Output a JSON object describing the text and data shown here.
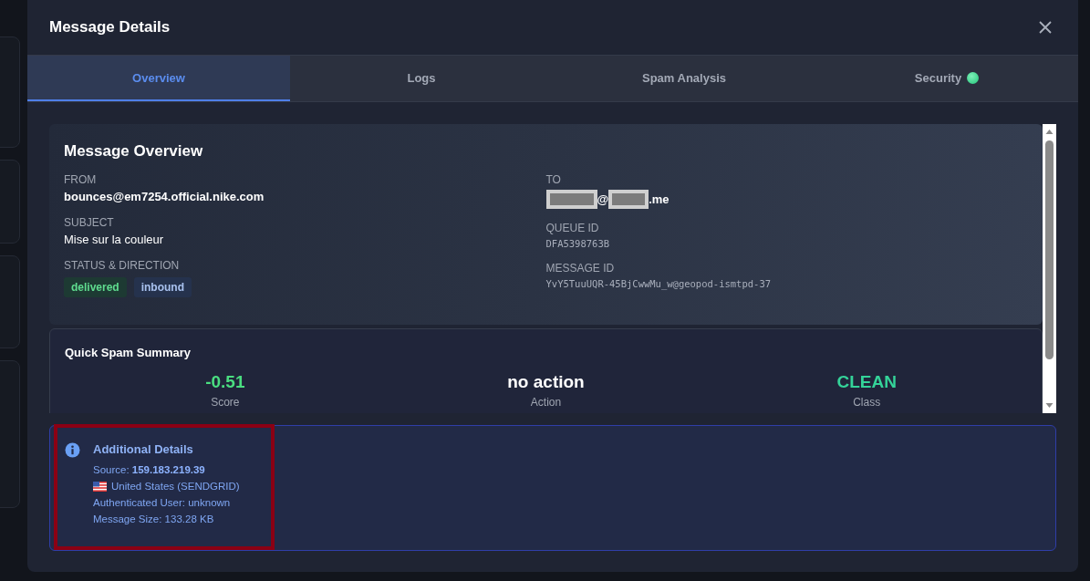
{
  "window": {
    "title": "Message Details"
  },
  "tabs": [
    {
      "label": "Overview",
      "selected": true,
      "indicator": false
    },
    {
      "label": "Logs",
      "selected": false,
      "indicator": false
    },
    {
      "label": "Spam Analysis",
      "selected": false,
      "indicator": false
    },
    {
      "label": "Security",
      "selected": false,
      "indicator": true
    }
  ],
  "overview": {
    "title": "Message Overview",
    "from": {
      "label": "FROM",
      "value": "bounces@em7254.official.nike.com"
    },
    "subject": {
      "label": "SUBJECT",
      "value": "Mise sur la couleur"
    },
    "status": {
      "label": "STATUS & DIRECTION",
      "badges": [
        {
          "text": "delivered",
          "kind": "status"
        },
        {
          "text": "inbound",
          "kind": "direction"
        }
      ]
    },
    "to": {
      "label": "TO",
      "visible_parts": [
        "@",
        ".me"
      ]
    },
    "queue_id": {
      "label": "QUEUE ID",
      "value": "DFA5398763B"
    },
    "message_id": {
      "label": "MESSAGE ID",
      "value": "YvY5TuuUQR-45BjCwwMu_w@geopod-ismtpd-37"
    }
  },
  "spam_summary": {
    "title": "Quick Spam Summary",
    "metrics": [
      {
        "value": "-0.51",
        "label": "Score",
        "color": "#4ade80"
      },
      {
        "value": "no action",
        "label": "Action",
        "color": "#ffffff"
      },
      {
        "value": "CLEAN",
        "label": "Class",
        "color": "#34d399"
      }
    ]
  },
  "additional_details": {
    "title": "Additional Details",
    "lines": [
      {
        "kind": "text",
        "text": "Source: **159.183.219.39**"
      },
      {
        "kind": "flag",
        "text": "United States (SENDGRID)"
      },
      {
        "kind": "text",
        "text": "Authenticated User: unknown"
      },
      {
        "kind": "text",
        "text": "Message Size: 133.28 KB"
      }
    ]
  }
}
